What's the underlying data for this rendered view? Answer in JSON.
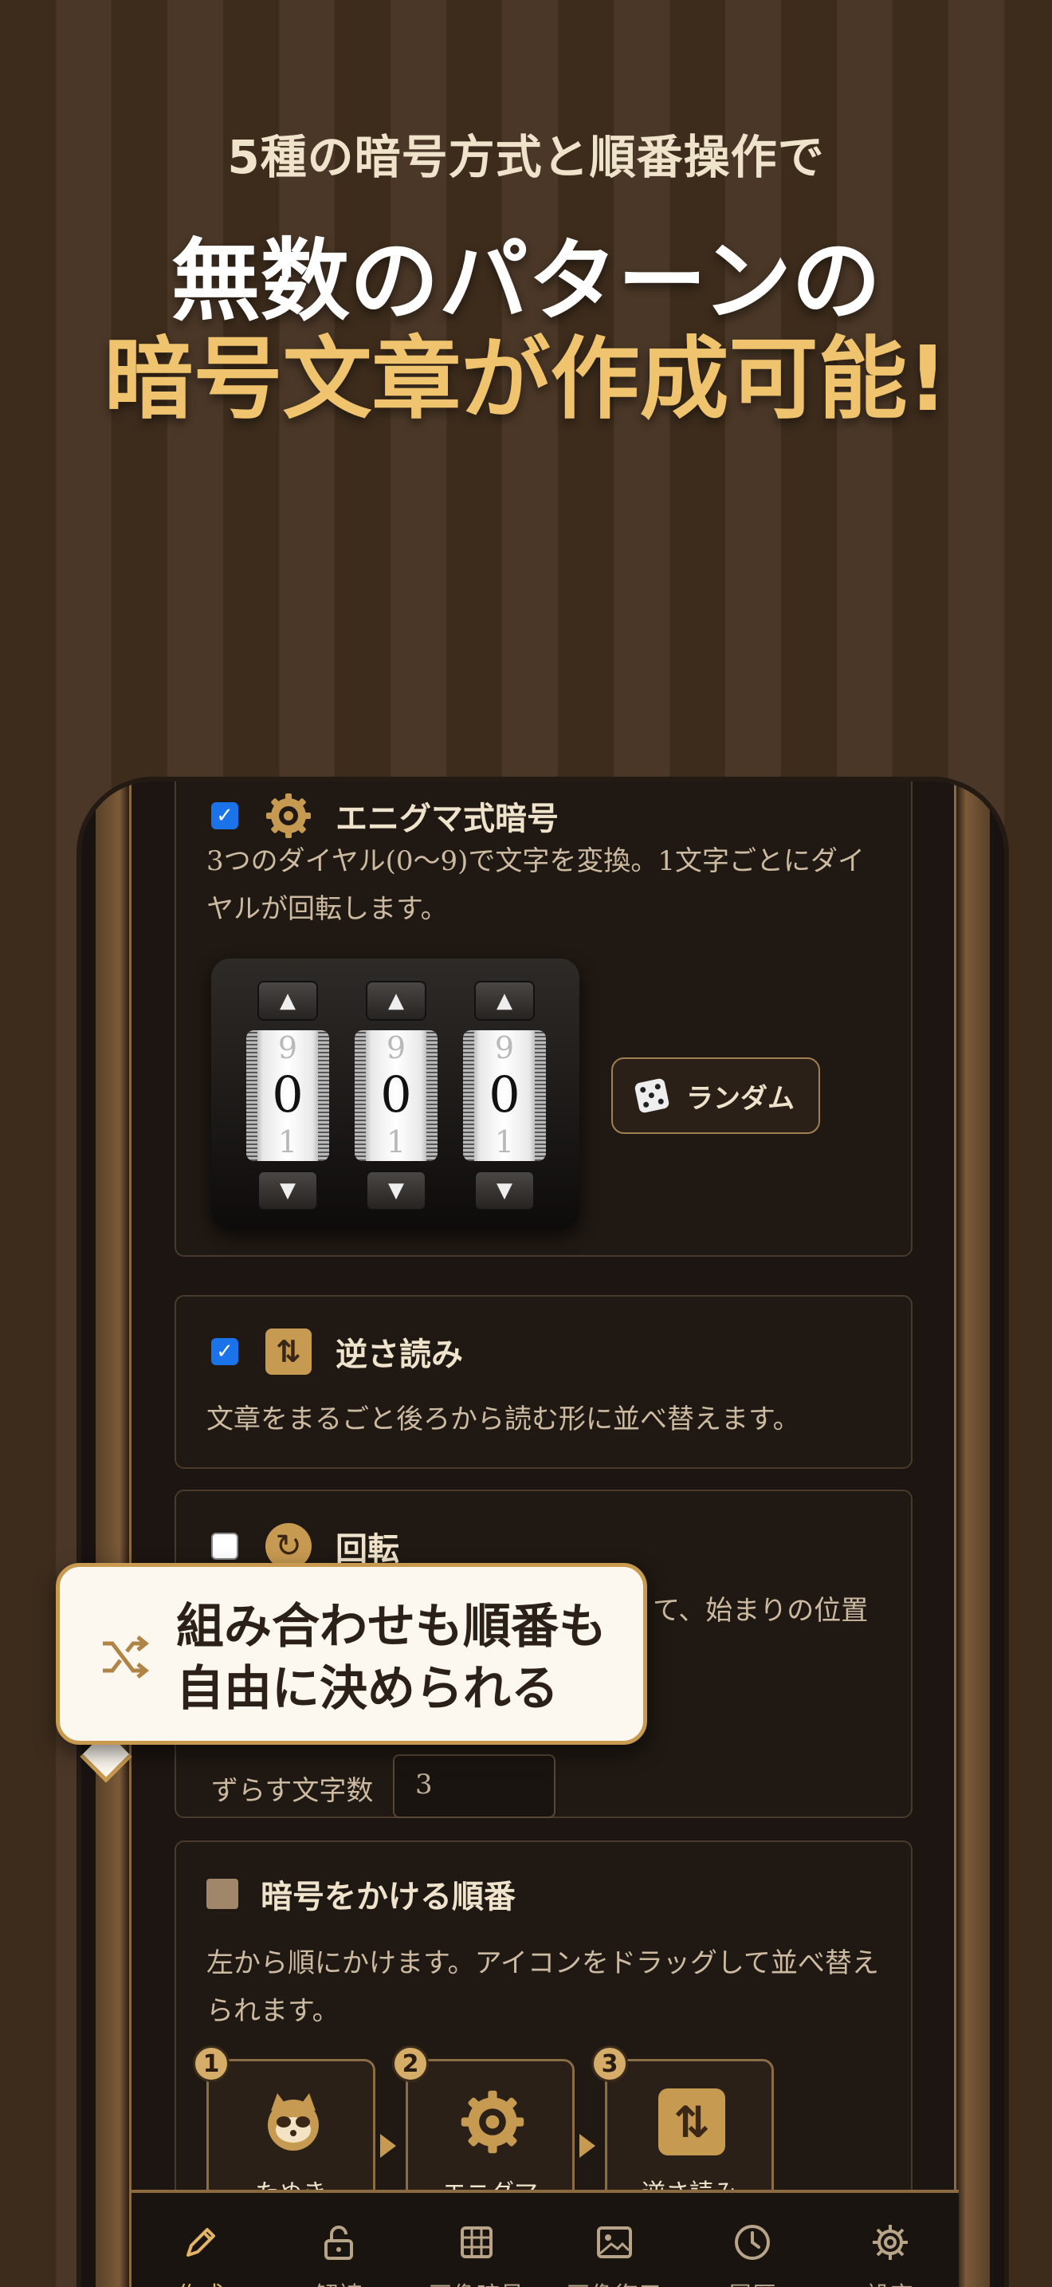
{
  "promo": {
    "subtitle": "5種の暗号方式と順番操作で",
    "headline_line1": "無数のパターンの",
    "headline_line2": "暗号文章が作成可能!"
  },
  "cards": {
    "enigma": {
      "title": "エニグマ式暗号",
      "checked": true,
      "description": "3つのダイヤル(0〜9)で文字を変換。1文字ごとにダイヤルが回転します。",
      "dials": [
        {
          "prev": "9",
          "current": "0",
          "next": "1"
        },
        {
          "prev": "9",
          "current": "0",
          "next": "1"
        },
        {
          "prev": "9",
          "current": "0",
          "next": "1"
        }
      ],
      "random_label": "ランダム"
    },
    "reverse": {
      "title": "逆さ読み",
      "checked": true,
      "description": "文章をまるごと後ろから読む形に並べ替えます。"
    },
    "rotate": {
      "title": "回転",
      "checked": false,
      "description_visible": "て、始まりの位置",
      "shift_label": "ずらす文字数",
      "shift_value": "3"
    }
  },
  "order": {
    "title": "暗号をかける順番",
    "description": "左から順にかけます。アイコンをドラッグして並べ替えられます。",
    "steps": [
      {
        "num": "1",
        "label": "たぬき"
      },
      {
        "num": "2",
        "label": "エニグマ"
      },
      {
        "num": "3",
        "label": "逆さ読み"
      }
    ]
  },
  "callout": {
    "line1": "組み合わせも順番も",
    "line2": "自由に決められる"
  },
  "tabs": [
    {
      "label": "作成",
      "icon": "pencil-icon",
      "active": true
    },
    {
      "label": "解読",
      "icon": "unlock-icon",
      "active": false
    },
    {
      "label": "画像暗号",
      "icon": "grid-icon",
      "active": false
    },
    {
      "label": "画像復元",
      "icon": "image-icon",
      "active": false
    },
    {
      "label": "履歴",
      "icon": "clock-icon",
      "active": false
    },
    {
      "label": "設定",
      "icon": "gear-icon",
      "active": false
    }
  ],
  "colors": {
    "accent": "#c79a52",
    "active_tab": "#e3b468",
    "checkbox": "#1a73e8"
  }
}
